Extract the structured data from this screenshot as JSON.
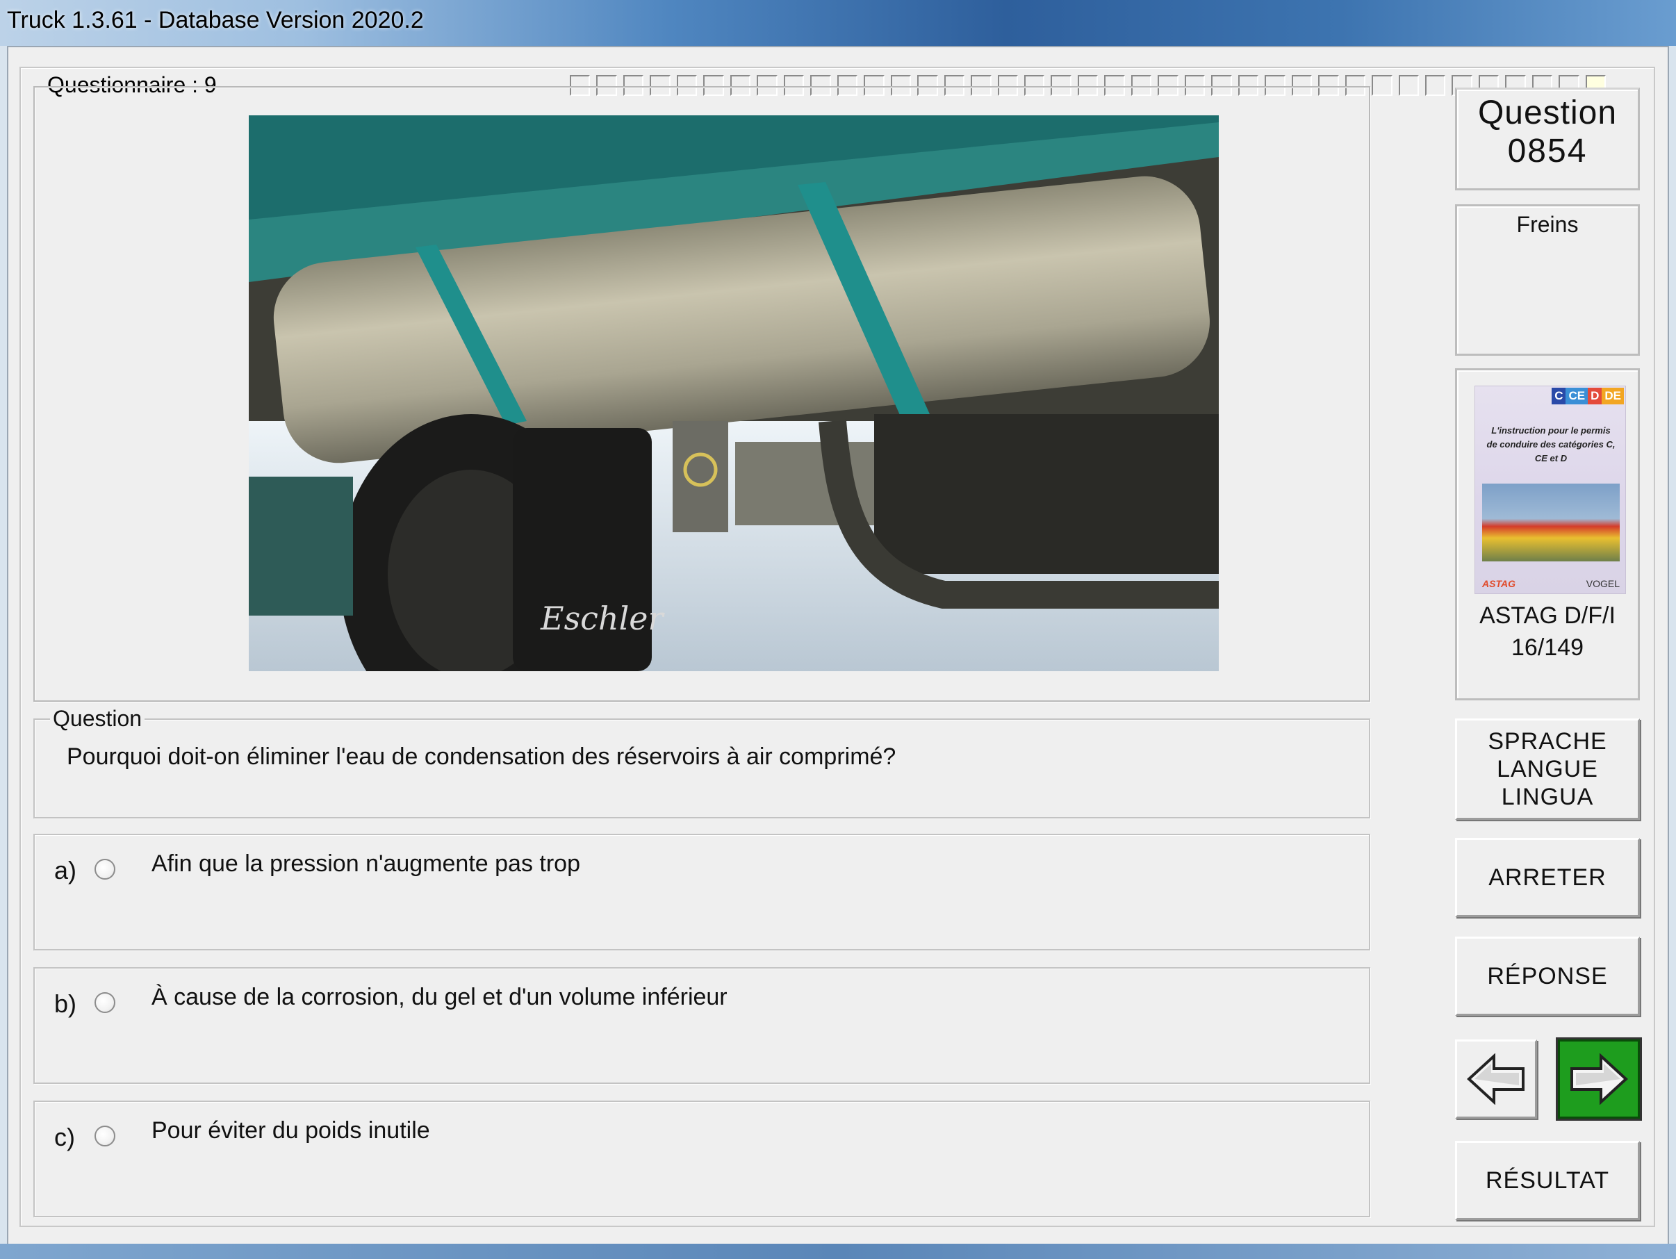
{
  "window": {
    "title": "Truck 1.3.61 - Database Version 2020.2"
  },
  "quiz": {
    "legend": "Questionnaire : 9",
    "progress_cells": 39,
    "progress_current": 38
  },
  "side": {
    "question_label": "Question",
    "question_number": "0854",
    "category": "Freins",
    "book": {
      "badges": [
        "C",
        "CE",
        "D",
        "DE"
      ],
      "badge_colors": [
        "#2a4aa8",
        "#3a8fd6",
        "#e44a3a",
        "#f2a623"
      ],
      "cover_text": "L'instruction pour le permis de conduire des catégories C, CE et D",
      "logo_left": "ASTAG",
      "logo_right": "VOGEL",
      "source": "ASTAG D/F/I",
      "page": "16/149"
    },
    "buttons": {
      "language": [
        "SPRACHE",
        "LANGUE",
        "LINGUA"
      ],
      "stop": "ARRETER",
      "answer": "RÉPONSE",
      "result": "RÉSULTAT"
    },
    "nav": {
      "prev_icon": "arrow-left-icon",
      "next_icon": "arrow-right-icon",
      "next_color": "#1e9d1e"
    }
  },
  "question": {
    "legend": "Question",
    "text": "Pourquoi doit-on éliminer l'eau de condensation des réservoirs à air comprimé?"
  },
  "answers": [
    {
      "letter": "a)",
      "text": "Afin que la pression n'augmente pas trop"
    },
    {
      "letter": "b)",
      "text": "À cause de la corrosion, du gel et d'un volume inférieur"
    },
    {
      "letter": "c)",
      "text": "Pour éviter du poids inutile"
    }
  ],
  "photo": {
    "brand_text": "Eschler"
  }
}
